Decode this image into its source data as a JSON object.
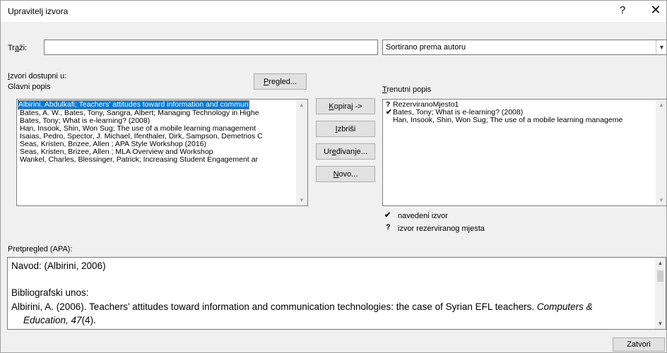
{
  "window": {
    "title": "Upravitelj izvora",
    "help_label": "?",
    "close_label": "✕"
  },
  "search": {
    "label_pre": "Tr",
    "label_accel": "a",
    "label_post": "ži:",
    "value": ""
  },
  "sort": {
    "selected": "Sortirano prema autoru"
  },
  "sources_available": {
    "label_accel": "I",
    "label_rest": "zvori dostupni u:",
    "list_name": "Glavni popis",
    "browse_accel": "P",
    "browse_rest": "regled...",
    "items": [
      "Albirini, Abdulkafi; Teachers' attitudes toward information and commun",
      "Bates, A. W., Bates, Tony, Sangra, Albert; Managing Technology in Highe",
      "Bates, Tony; What is e-learning? (2008)",
      "Han, Insook, Shin, Won Sug; The use of a mobile learning management",
      "Isaias, Pedro, Spector, J. Michael, Ifenthaler, Dirk, Sampson, Demetrios C",
      "Seas, Kristen, Brizee, Allen ; APA Style Workshop (2016)",
      "Seas, Kristen, Brizee, Allen ; MLA Overview and Workshop",
      "Wankel, Charles, Blessinger, Patrick; Increasing Student Engagement ar"
    ]
  },
  "actions": {
    "copy_accel": "K",
    "copy_rest": "opiraj ->",
    "delete_accel": "I",
    "delete_rest": "zbriši",
    "edit_pre": "Ur",
    "edit_accel": "e",
    "edit_post": "đivanje...",
    "new_accel": "N",
    "new_rest": "ovo..."
  },
  "current_list": {
    "label_accel": "T",
    "label_rest": "renutni popis",
    "items": [
      {
        "mark": "?",
        "text": "RezerviranoMjesto1"
      },
      {
        "mark": "✔",
        "text": "Bates, Tony; What is e-learning? (2008)"
      },
      {
        "mark": "",
        "text": "Han, Insook, Shin, Won Sug; The use of a mobile learning manageme"
      }
    ]
  },
  "legend": {
    "cited_mark": "✔",
    "cited_label": "navedeni izvor",
    "placeholder_mark": "?",
    "placeholder_label": "izvor rezerviranog mjesta"
  },
  "preview": {
    "label": "Pretpregled (APA):",
    "citation": "Navod:  (Albirini, 2006)",
    "bibliography_heading": "Bibliografski unos:",
    "entry_main": "Albirini, A. (2006). Teachers’ attitudes toward information and communication technologies: the case of Syrian EFL teachers. ",
    "entry_journal": "Computers &",
    "entry_journal_cont": "Education, 47",
    "entry_issue": "(4)."
  },
  "footer": {
    "close_button": "Zatvori"
  }
}
